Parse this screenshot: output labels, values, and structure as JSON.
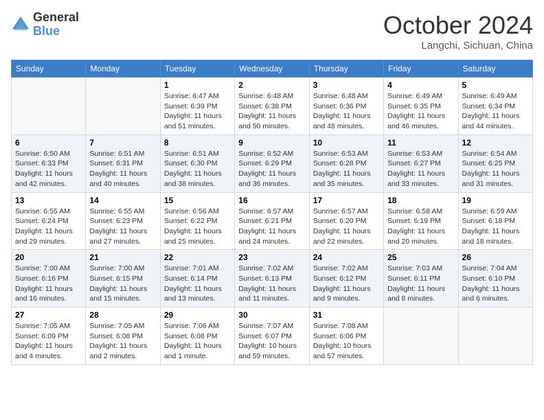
{
  "header": {
    "logo_text_general": "General",
    "logo_text_blue": "Blue",
    "month": "October 2024",
    "location": "Langchi, Sichuan, China"
  },
  "weekdays": [
    "Sunday",
    "Monday",
    "Tuesday",
    "Wednesday",
    "Thursday",
    "Friday",
    "Saturday"
  ],
  "weeks": [
    [
      {
        "day": "",
        "content": ""
      },
      {
        "day": "",
        "content": ""
      },
      {
        "day": "1",
        "content": "Sunrise: 6:47 AM\nSunset: 6:39 PM\nDaylight: 11 hours and 51 minutes."
      },
      {
        "day": "2",
        "content": "Sunrise: 6:48 AM\nSunset: 6:38 PM\nDaylight: 11 hours and 50 minutes."
      },
      {
        "day": "3",
        "content": "Sunrise: 6:48 AM\nSunset: 6:36 PM\nDaylight: 11 hours and 48 minutes."
      },
      {
        "day": "4",
        "content": "Sunrise: 6:49 AM\nSunset: 6:35 PM\nDaylight: 11 hours and 46 minutes."
      },
      {
        "day": "5",
        "content": "Sunrise: 6:49 AM\nSunset: 6:34 PM\nDaylight: 11 hours and 44 minutes."
      }
    ],
    [
      {
        "day": "6",
        "content": "Sunrise: 6:50 AM\nSunset: 6:33 PM\nDaylight: 11 hours and 42 minutes."
      },
      {
        "day": "7",
        "content": "Sunrise: 6:51 AM\nSunset: 6:31 PM\nDaylight: 11 hours and 40 minutes."
      },
      {
        "day": "8",
        "content": "Sunrise: 6:51 AM\nSunset: 6:30 PM\nDaylight: 11 hours and 38 minutes."
      },
      {
        "day": "9",
        "content": "Sunrise: 6:52 AM\nSunset: 6:29 PM\nDaylight: 11 hours and 36 minutes."
      },
      {
        "day": "10",
        "content": "Sunrise: 6:53 AM\nSunset: 6:28 PM\nDaylight: 11 hours and 35 minutes."
      },
      {
        "day": "11",
        "content": "Sunrise: 6:53 AM\nSunset: 6:27 PM\nDaylight: 11 hours and 33 minutes."
      },
      {
        "day": "12",
        "content": "Sunrise: 6:54 AM\nSunset: 6:25 PM\nDaylight: 11 hours and 31 minutes."
      }
    ],
    [
      {
        "day": "13",
        "content": "Sunrise: 6:55 AM\nSunset: 6:24 PM\nDaylight: 11 hours and 29 minutes."
      },
      {
        "day": "14",
        "content": "Sunrise: 6:55 AM\nSunset: 6:23 PM\nDaylight: 11 hours and 27 minutes."
      },
      {
        "day": "15",
        "content": "Sunrise: 6:56 AM\nSunset: 6:22 PM\nDaylight: 11 hours and 25 minutes."
      },
      {
        "day": "16",
        "content": "Sunrise: 6:57 AM\nSunset: 6:21 PM\nDaylight: 11 hours and 24 minutes."
      },
      {
        "day": "17",
        "content": "Sunrise: 6:57 AM\nSunset: 6:20 PM\nDaylight: 11 hours and 22 minutes."
      },
      {
        "day": "18",
        "content": "Sunrise: 6:58 AM\nSunset: 6:19 PM\nDaylight: 11 hours and 20 minutes."
      },
      {
        "day": "19",
        "content": "Sunrise: 6:59 AM\nSunset: 6:18 PM\nDaylight: 11 hours and 18 minutes."
      }
    ],
    [
      {
        "day": "20",
        "content": "Sunrise: 7:00 AM\nSunset: 6:16 PM\nDaylight: 11 hours and 16 minutes."
      },
      {
        "day": "21",
        "content": "Sunrise: 7:00 AM\nSunset: 6:15 PM\nDaylight: 11 hours and 15 minutes."
      },
      {
        "day": "22",
        "content": "Sunrise: 7:01 AM\nSunset: 6:14 PM\nDaylight: 11 hours and 13 minutes."
      },
      {
        "day": "23",
        "content": "Sunrise: 7:02 AM\nSunset: 6:13 PM\nDaylight: 11 hours and 11 minutes."
      },
      {
        "day": "24",
        "content": "Sunrise: 7:02 AM\nSunset: 6:12 PM\nDaylight: 11 hours and 9 minutes."
      },
      {
        "day": "25",
        "content": "Sunrise: 7:03 AM\nSunset: 6:11 PM\nDaylight: 11 hours and 8 minutes."
      },
      {
        "day": "26",
        "content": "Sunrise: 7:04 AM\nSunset: 6:10 PM\nDaylight: 11 hours and 6 minutes."
      }
    ],
    [
      {
        "day": "27",
        "content": "Sunrise: 7:05 AM\nSunset: 6:09 PM\nDaylight: 11 hours and 4 minutes."
      },
      {
        "day": "28",
        "content": "Sunrise: 7:05 AM\nSunset: 6:08 PM\nDaylight: 11 hours and 2 minutes."
      },
      {
        "day": "29",
        "content": "Sunrise: 7:06 AM\nSunset: 6:08 PM\nDaylight: 11 hours and 1 minute."
      },
      {
        "day": "30",
        "content": "Sunrise: 7:07 AM\nSunset: 6:07 PM\nDaylight: 10 hours and 59 minutes."
      },
      {
        "day": "31",
        "content": "Sunrise: 7:08 AM\nSunset: 6:06 PM\nDaylight: 10 hours and 57 minutes."
      },
      {
        "day": "",
        "content": ""
      },
      {
        "day": "",
        "content": ""
      }
    ]
  ]
}
